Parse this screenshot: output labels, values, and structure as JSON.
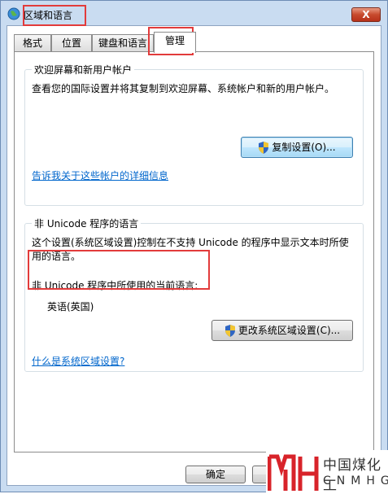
{
  "window": {
    "title": "区域和语言",
    "close_label": "X"
  },
  "tabs": [
    {
      "label": "格式"
    },
    {
      "label": "位置"
    },
    {
      "label": "键盘和语言"
    },
    {
      "label": "管理"
    }
  ],
  "welcome_group": {
    "title": "欢迎屏幕和新用户帐户",
    "description": "查看您的国际设置并将其复制到欢迎屏幕、系统帐户和新的用户帐户。",
    "copy_button": "复制设置(O)...",
    "details_link": "告诉我关于这些帐户的详细信息"
  },
  "unicode_group": {
    "title": "非 Unicode 程序的语言",
    "description_line1": "这个设置(系统区域设置)控制在不支持 Unicode 的程序中显示文本时所使",
    "description_line2": "用的语言。",
    "current_label": "非 Unicode 程序中所使用的当前语言:",
    "current_value": "英语(英国)",
    "change_button": "更改系统区域设置(C)...",
    "help_link": "什么是系统区域设置?"
  },
  "footer": {
    "ok_button": "确定"
  },
  "watermark": {
    "cn": "中国煤化工",
    "en": "CNMHG"
  },
  "colors": {
    "annotation": "#e23b3b",
    "link": "#0066cc",
    "frame": "#c9dcf1"
  }
}
